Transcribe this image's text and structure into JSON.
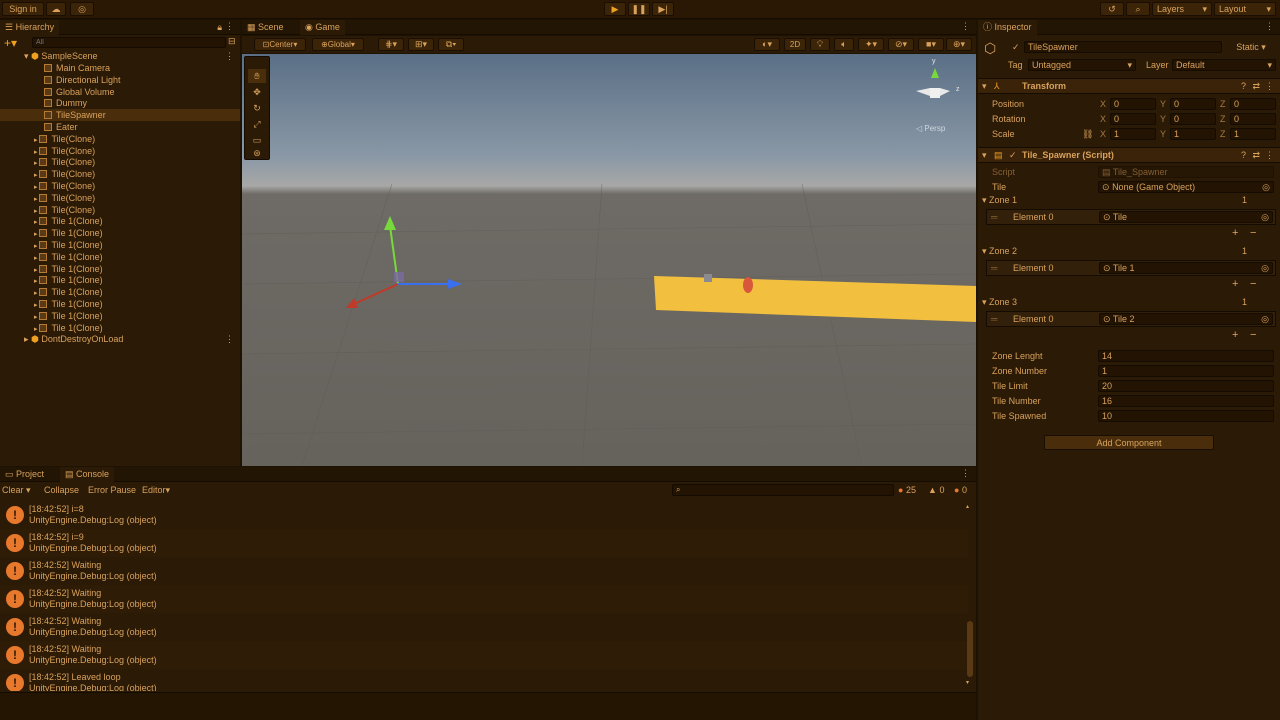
{
  "topbar": {
    "signin": "Sign in",
    "layers": "Layers",
    "layout": "Layout",
    "cloud_icon": "cloud-icon",
    "play_icon": "play-icon"
  },
  "hierarchy": {
    "tab": "Hierarchy",
    "search_placeholder": "All",
    "scene": "SampleScene",
    "items": [
      "Main Camera",
      "Directional Light",
      "Global Volume",
      "Dummy",
      "TileSpawner",
      "Eater"
    ],
    "clones": [
      "Tile(Clone)",
      "Tile(Clone)",
      "Tile(Clone)",
      "Tile(Clone)",
      "Tile(Clone)",
      "Tile(Clone)",
      "Tile(Clone)",
      "Tile 1(Clone)",
      "Tile 1(Clone)",
      "Tile 1(Clone)",
      "Tile 1(Clone)",
      "Tile 1(Clone)",
      "Tile 1(Clone)",
      "Tile 1(Clone)",
      "Tile 1(Clone)",
      "Tile 1(Clone)",
      "Tile 1(Clone)"
    ],
    "dontdestroy": "DontDestroyOnLoad"
  },
  "scene": {
    "tab_scene": "Scene",
    "tab_game": "Game",
    "center": "Center",
    "global": "Global",
    "btn_2d": "2D",
    "persp": "Persp"
  },
  "inspector": {
    "tab": "Inspector",
    "object_name": "TileSpawner",
    "static_label": "Static",
    "tag_label": "Tag",
    "tag_value": "Untagged",
    "layer_label": "Layer",
    "layer_value": "Default",
    "transform": {
      "title": "Transform",
      "position_label": "Position",
      "rotation_label": "Rotation",
      "scale_label": "Scale",
      "position": [
        "0",
        "0",
        "0"
      ],
      "rotation": [
        "0",
        "0",
        "0"
      ],
      "scale": [
        "1",
        "1",
        "1"
      ],
      "axes": [
        "X",
        "Y",
        "Z"
      ]
    },
    "script": {
      "title": "Tile_Spawner (Script)",
      "script_label": "Script",
      "script_value": "Tile_Spawner",
      "tile_label": "Tile",
      "tile_value": "None (Game Object)",
      "zones": [
        {
          "label": "Zone 1",
          "count": "1",
          "element": "Element 0",
          "value": "Tile"
        },
        {
          "label": "Zone 2",
          "count": "1",
          "element": "Element 0",
          "value": "Tile 1"
        },
        {
          "label": "Zone 3",
          "count": "1",
          "element": "Element 0",
          "value": "Tile 2"
        }
      ],
      "fields": [
        {
          "label": "Zone Lenght",
          "value": "14"
        },
        {
          "label": "Zone Number",
          "value": "1"
        },
        {
          "label": "Tile Limit",
          "value": "20"
        },
        {
          "label": "Tile Number",
          "value": "16"
        },
        {
          "label": "Tile Spawned",
          "value": "10"
        }
      ]
    },
    "add_component": "Add Component"
  },
  "console": {
    "tab_project": "Project",
    "tab_console": "Console",
    "clear": "Clear",
    "collapse": "Collapse",
    "error_pause": "Error Pause",
    "editor": "Editor",
    "warn_count": "25",
    "info_count": "0",
    "err_count": "0",
    "logs": [
      {
        "msg": "[18:42:52] i=8",
        "src": "UnityEngine.Debug:Log (object)"
      },
      {
        "msg": "[18:42:52] i=9",
        "src": "UnityEngine.Debug:Log (object)"
      },
      {
        "msg": "[18:42:52] Waiting",
        "src": "UnityEngine.Debug:Log (object)"
      },
      {
        "msg": "[18:42:52] Waiting",
        "src": "UnityEngine.Debug:Log (object)"
      },
      {
        "msg": "[18:42:52] Waiting",
        "src": "UnityEngine.Debug:Log (object)"
      },
      {
        "msg": "[18:42:52] Waiting",
        "src": "UnityEngine.Debug:Log (object)"
      },
      {
        "msg": "[18:42:52] Leaved loop",
        "src": "UnityEngine.Debug:Log (object)"
      }
    ]
  },
  "colors": {
    "accent": "#f0a020",
    "tile": "#f5c040",
    "warning": "#e8792c"
  }
}
